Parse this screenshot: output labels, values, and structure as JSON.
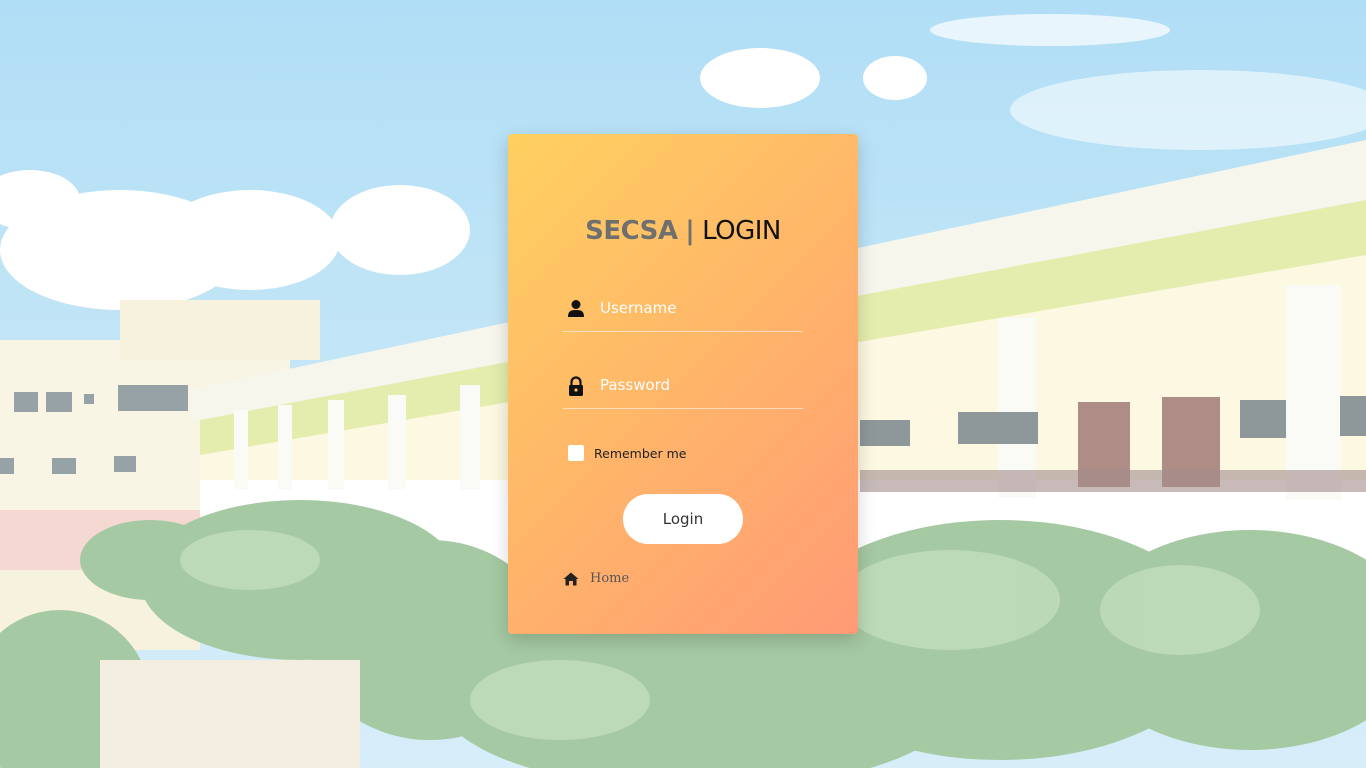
{
  "login": {
    "title_brand": "SECSA",
    "title_separator": "|",
    "title_word": "LOGIN",
    "username_placeholder": "Username",
    "password_placeholder": "Password",
    "remember_label": "Remember me",
    "login_button": "Login",
    "home_link": "Home"
  },
  "icons": {
    "username": "user-icon",
    "password": "lock-icon",
    "home": "home-icon"
  },
  "colors": {
    "card_gradient_start": "#ffd060",
    "card_gradient_end": "#ff9a76",
    "title_brand": "#6f6f6f",
    "title_word": "#111111"
  }
}
